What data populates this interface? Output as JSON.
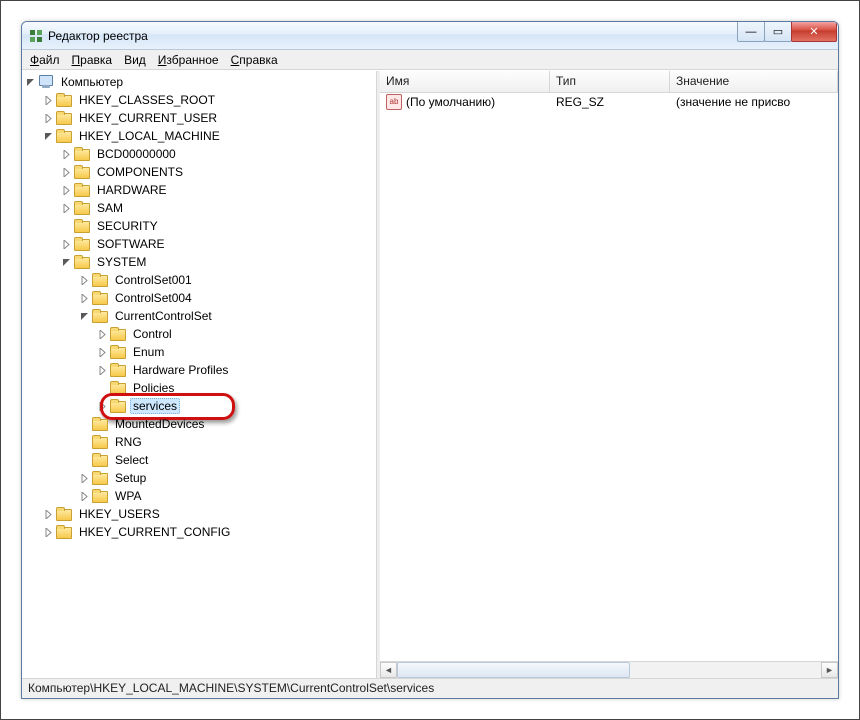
{
  "window": {
    "title": "Редактор реестра"
  },
  "menu": {
    "file_pre": "Ф",
    "file_post": "айл",
    "edit_pre": "П",
    "edit_post": "равка",
    "view": "Вид",
    "fav_pre": "И",
    "fav_post": "збранное",
    "help_pre": "С",
    "help_post": "правка"
  },
  "columns": {
    "name": "Имя",
    "type": "Тип",
    "value": "Значение"
  },
  "default_row": {
    "icon_text": "ab",
    "name": "(По умолчанию)",
    "type": "REG_SZ",
    "value": "(значение не присво"
  },
  "statusbar": "Компьютер\\HKEY_LOCAL_MACHINE\\SYSTEM\\CurrentControlSet\\services",
  "tree": {
    "root": "Компьютер",
    "hcr": "HKEY_CLASSES_ROOT",
    "hcu": "HKEY_CURRENT_USER",
    "hlm": "HKEY_LOCAL_MACHINE",
    "bcd": "BCD00000000",
    "components": "COMPONENTS",
    "hardware": "HARDWARE",
    "sam": "SAM",
    "security": "SECURITY",
    "software": "SOFTWARE",
    "system": "SYSTEM",
    "cs001": "ControlSet001",
    "cs004": "ControlSet004",
    "ccs": "CurrentControlSet",
    "control": "Control",
    "enum": "Enum",
    "hwprofiles": "Hardware Profiles",
    "policies": "Policies",
    "services": "services",
    "mounted": "MountedDevices",
    "rng": "RNG",
    "select": "Select",
    "setup": "Setup",
    "wpa": "WPA",
    "hu": "HKEY_USERS",
    "hcc": "HKEY_CURRENT_CONFIG"
  }
}
